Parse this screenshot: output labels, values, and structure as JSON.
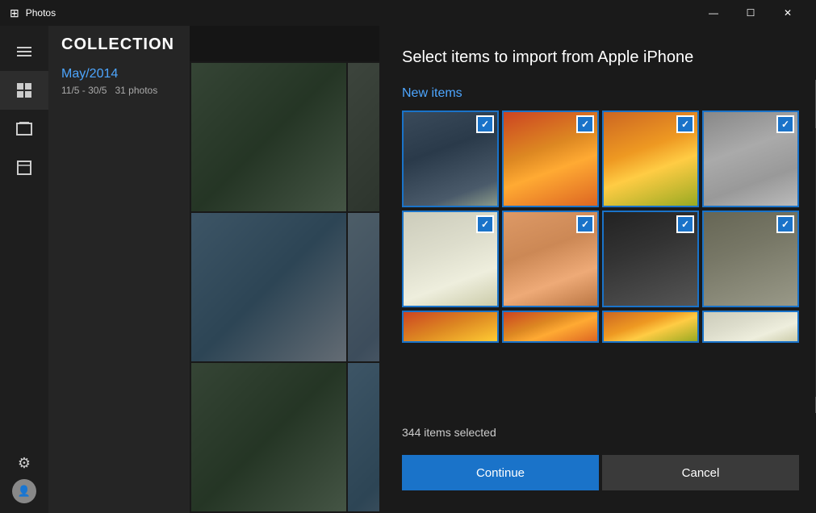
{
  "titlebar": {
    "app_name": "Photos",
    "minimize_label": "—",
    "maximize_label": "☐",
    "close_label": "✕"
  },
  "sidebar": {
    "collection_title": "COLLECTION",
    "month_label": "May/2014",
    "date_range": "11/5 - 30/5",
    "photo_count": "31 photos"
  },
  "toolbar": {
    "refresh_icon": "↺",
    "list_icon": "≡",
    "download_icon": "⬇",
    "more_icon": "…"
  },
  "dialog": {
    "title": "Select items to import from Apple iPhone",
    "section_label": "New items",
    "items_selected": "344 items selected",
    "continue_label": "Continue",
    "cancel_label": "Cancel"
  },
  "photos": [
    {
      "class": "p-building",
      "checked": true
    },
    {
      "class": "p-fruits1",
      "checked": true
    },
    {
      "class": "p-fruits2",
      "checked": true
    },
    {
      "class": "p-seafood1",
      "checked": true
    },
    {
      "class": "p-garlic",
      "checked": true
    },
    {
      "class": "p-shrimp",
      "checked": true
    },
    {
      "class": "p-mussels",
      "checked": true
    },
    {
      "class": "p-shellfish",
      "checked": true
    }
  ],
  "partial_photos": [
    {
      "class": "p-partial"
    },
    {
      "class": "p-fruits1"
    },
    {
      "class": "p-fruits2"
    },
    {
      "class": "p-garlic"
    }
  ],
  "check_symbol": "✓"
}
